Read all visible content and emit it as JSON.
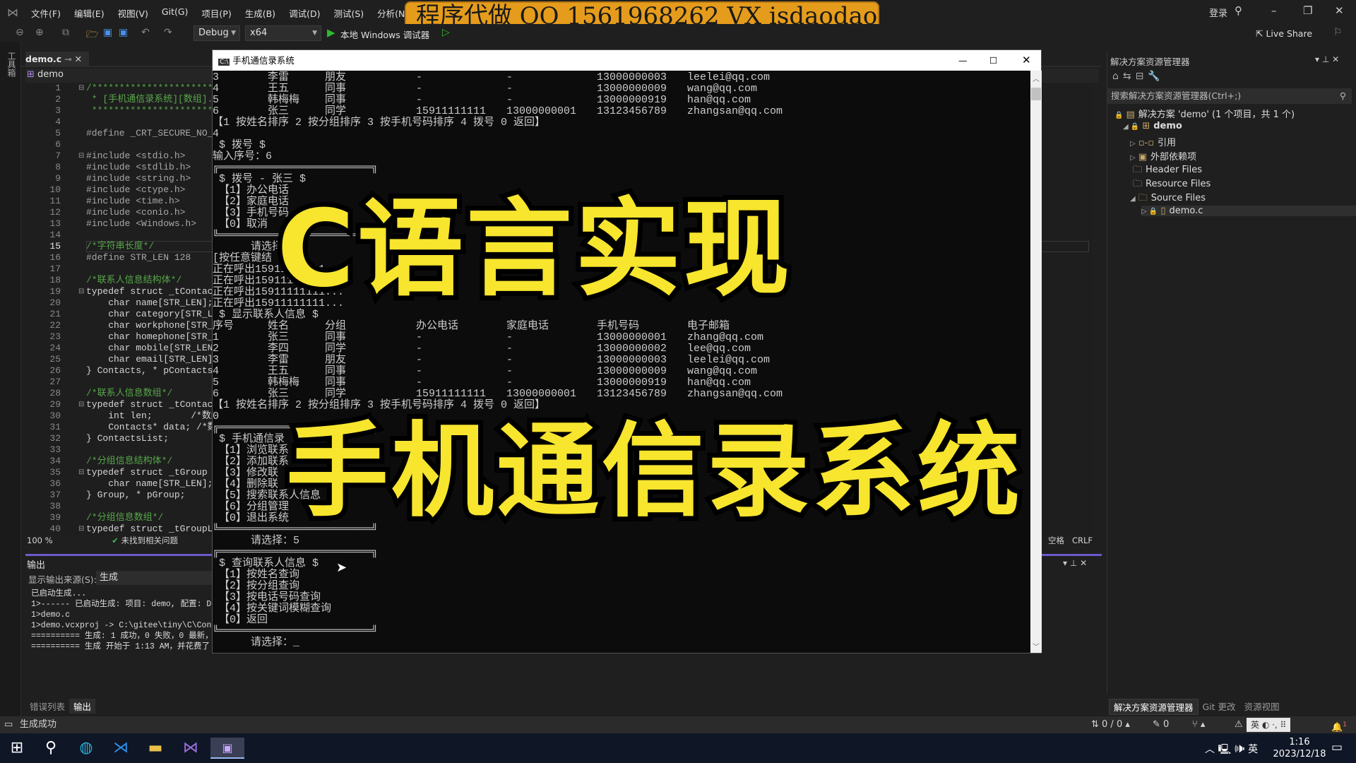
{
  "titlebar": {
    "menu": [
      "文件(F)",
      "编辑(E)",
      "视图(V)",
      "Git(G)",
      "项目(P)",
      "生成(B)",
      "调试(D)",
      "测试(S)",
      "分析(N)"
    ],
    "login": "登录",
    "watermark": "程序代做 QQ 1561968262 VX isdaodao"
  },
  "toolbar": {
    "config": "Debug",
    "platform": "x64",
    "run_label": "本地 Windows 调试器",
    "live_share": "Live Share"
  },
  "left_strip_label": "工具箱",
  "editor": {
    "tab": "demo.c",
    "nav_project": "demo",
    "current_line": 15,
    "zoom": "100 %",
    "issues": "未找到相关问题",
    "whitespace": "空格",
    "line_ending": "CRLF",
    "lines": [
      {
        "kind": "comment",
        "text": "/************************",
        "fold": true
      },
      {
        "kind": "comment",
        "text": " * [手机通信录系统][数组]."
      },
      {
        "kind": "comment",
        "text": " ************************"
      },
      {
        "kind": "code",
        "text": ""
      },
      {
        "kind": "pre",
        "text": "#define _CRT_SECURE_NO_WA"
      },
      {
        "kind": "code",
        "text": ""
      },
      {
        "kind": "pre",
        "text": "#include <stdio.h>",
        "fold": true
      },
      {
        "kind": "pre",
        "text": "#include <stdlib.h>"
      },
      {
        "kind": "pre",
        "text": "#include <string.h>"
      },
      {
        "kind": "pre",
        "text": "#include <ctype.h>"
      },
      {
        "kind": "pre",
        "text": "#include <time.h>"
      },
      {
        "kind": "pre",
        "text": "#include <conio.h>"
      },
      {
        "kind": "pre",
        "text": "#include <Windows.h>"
      },
      {
        "kind": "code",
        "text": ""
      },
      {
        "kind": "comment",
        "text": "/*字符串长度*/"
      },
      {
        "kind": "pre",
        "text": "#define STR_LEN 128"
      },
      {
        "kind": "code",
        "text": ""
      },
      {
        "kind": "comment",
        "text": "/*联系人信息结构体*/"
      },
      {
        "kind": "code",
        "text": "typedef struct _tContacts",
        "fold": true
      },
      {
        "kind": "code",
        "text": "    char name[STR_LEN];"
      },
      {
        "kind": "code",
        "text": "    char category[STR_LEN"
      },
      {
        "kind": "code",
        "text": "    char workphone[STR_LE"
      },
      {
        "kind": "code",
        "text": "    char homephone[STR_LE"
      },
      {
        "kind": "code",
        "text": "    char mobile[STR_LEN];"
      },
      {
        "kind": "code",
        "text": "    char email[STR_LEN];"
      },
      {
        "kind": "code",
        "text": "} Contacts, * pContacts;"
      },
      {
        "kind": "code",
        "text": ""
      },
      {
        "kind": "comment",
        "text": "/*联系人信息数组*/"
      },
      {
        "kind": "code",
        "text": "typedef struct _tContacts",
        "fold": true
      },
      {
        "kind": "code",
        "text": "    int len;       /*数组"
      },
      {
        "kind": "code",
        "text": "    Contacts* data; /*数组"
      },
      {
        "kind": "code",
        "text": "} ContactsList;"
      },
      {
        "kind": "code",
        "text": ""
      },
      {
        "kind": "comment",
        "text": "/*分组信息结构体*/"
      },
      {
        "kind": "code",
        "text": "typedef struct _tGroup {",
        "fold": true
      },
      {
        "kind": "code",
        "text": "    char name[STR_LEN]; /"
      },
      {
        "kind": "code",
        "text": "} Group, * pGroup;"
      },
      {
        "kind": "code",
        "text": ""
      },
      {
        "kind": "comment",
        "text": "/*分组信息数组*/"
      },
      {
        "kind": "code",
        "text": "typedef struct _tGroupLis",
        "fold": true
      }
    ]
  },
  "output": {
    "title": "输出",
    "source_label": "显示输出来源(S):",
    "source_value": "生成",
    "lines": [
      "已启动生成...",
      "1>------ 已启动生成: 项目: demo, 配置: Debu",
      "1>demo.c",
      "1>demo.vcxproj -> C:\\gitee\\tiny\\C\\Console\\",
      "========== 生成: 1 成功，0 失败，0 最新，0",
      "========== 生成 开始于 1:13 AM，并花费了 01."
    ],
    "tabs": [
      "错误列表",
      "输出"
    ]
  },
  "solution_explorer": {
    "title": "解决方案资源管理器",
    "search_placeholder": "搜索解决方案资源管理器(Ctrl+;)",
    "tree": [
      {
        "label": "解决方案 'demo' (1 个项目，共 1 个)",
        "icon": "solution-icon"
      },
      {
        "label": "demo",
        "icon": "project-icon"
      },
      {
        "label": "引用",
        "icon": "references-icon"
      },
      {
        "label": "外部依赖项",
        "icon": "external-deps-icon"
      },
      {
        "label": "Header Files",
        "icon": "filter-folder-icon"
      },
      {
        "label": "Resource Files",
        "icon": "filter-folder-icon"
      },
      {
        "label": "Source Files",
        "icon": "filter-folder-icon"
      },
      {
        "label": "demo.c",
        "icon": "c-file-icon"
      }
    ],
    "tabs": [
      "解决方案资源管理器",
      "Git 更改",
      "资源视图"
    ]
  },
  "console": {
    "title": "手机通信录系统",
    "headers": [
      "序号",
      "姓名",
      "分组",
      "办公电话",
      "家庭电话",
      "手机号码",
      "电子邮箱"
    ],
    "top_rows": [
      [
        "3",
        "李雷",
        "朋友",
        "-",
        "-",
        "13000000003",
        "leelei@qq.com"
      ],
      [
        "4",
        "王五",
        "同事",
        "-",
        "-",
        "13000000009",
        "wang@qq.com"
      ],
      [
        "5",
        "韩梅梅",
        "同事",
        "-",
        "-",
        "13000000919",
        "han@qq.com"
      ],
      [
        "6",
        "张三",
        "同学",
        "15911111111",
        "13000000001",
        "13123456789",
        "zhangsan@qq.com"
      ]
    ],
    "rows": [
      [
        "1",
        "张三",
        "同事",
        "-",
        "-",
        "13000000001",
        "zhang@qq.com"
      ],
      [
        "2",
        "李四",
        "同学",
        "-",
        "-",
        "13000000002",
        "lee@qq.com"
      ],
      [
        "3",
        "李雷",
        "朋友",
        "-",
        "-",
        "13000000003",
        "leelei@qq.com"
      ],
      [
        "4",
        "王五",
        "同事",
        "-",
        "-",
        "13000000009",
        "wang@qq.com"
      ],
      [
        "5",
        "韩梅梅",
        "同事",
        "-",
        "-",
        "13000000919",
        "han@qq.com"
      ],
      [
        "6",
        "张三",
        "同学",
        "15911111111",
        "13000000001",
        "13123456789",
        "zhangsan@qq.com"
      ]
    ],
    "sort_menu": "【1 按姓名排序 2 按分组排序 3 按手机号码排序 4 拨号 0 返回】",
    "lines_a": [
      "4",
      " $ 拨号 $",
      "输入序号：6",
      "╔════════════════════════╗",
      " $ 拨号 - 张三 $",
      " 【1】办公电话",
      " 【2】家庭电话",
      " 【3】手机号码",
      " 【0】取消",
      "╚════════════════════════╝",
      "      请选择：",
      "[按任意键结",
      "正在呼出15911111111...",
      "正在呼出15911111111...",
      "正在呼出15911111111...",
      "正在呼出15911111111...",
      " $ 显示联系人信息 $"
    ],
    "lines_b": [
      "0",
      "╔════════════════════════╗",
      " $ 手机通信录",
      " 【1】浏览联系",
      " 【2】添加联系",
      " 【3】修改联",
      " 【4】删除联",
      " 【5】搜索联系人信息",
      " 【6】分组管理",
      " 【0】退出系统",
      "╚════════════════════════╝",
      "      请选择：5",
      "╔════════════════════════╗",
      " $ 查询联系人信息 $",
      " 【1】按姓名查询",
      " 【2】按分组查询",
      " 【3】按电话号码查询",
      " 【4】按关键词模糊查询",
      " 【0】返回",
      "╚════════════════════════╝",
      "      请选择：_"
    ]
  },
  "overlay": {
    "line1": "C语言实现",
    "line2": "手机通信录系统",
    "color": "#f7e52e"
  },
  "statusbar": {
    "message": "生成成功",
    "sync": "0 / 0",
    "edits": "0",
    "notifications": "1"
  },
  "taskbar": {
    "ime": "英",
    "time": "1:16",
    "date": "2023/12/18",
    "ime_popup": "英"
  }
}
